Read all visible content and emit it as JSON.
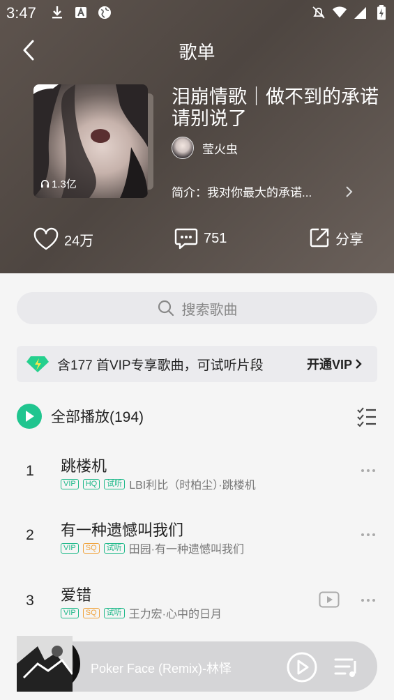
{
  "status_bar": {
    "time": "3:47",
    "left_icons": [
      "download-icon",
      "a-icon",
      "globe-icon"
    ],
    "right_icons": [
      "mute-icon",
      "wifi-icon",
      "signal-icon",
      "battery-icon"
    ]
  },
  "header": {
    "title": "歌单"
  },
  "playlist": {
    "play_count": "1.3亿",
    "title": "泪崩情歌｜做不到的承诺请别说了",
    "creator": "莹火虫",
    "intro": "简介：我对你最大的承诺..."
  },
  "actions": {
    "like_count": "24万",
    "comment_count": "751",
    "share_label": "分享"
  },
  "search": {
    "placeholder": "搜索歌曲"
  },
  "vip_banner": {
    "text": "含177 首VIP专享歌曲，可试听片段",
    "button": "开通VIP"
  },
  "play_all": {
    "label": "全部播放(194)"
  },
  "songs": [
    {
      "index": "1",
      "title": "跳楼机",
      "tags": [
        "VIP",
        "HQ",
        "试听"
      ],
      "meta": "LBI利比（时柏尘）·跳楼机"
    },
    {
      "index": "2",
      "title": "有一种遗憾叫我们",
      "tags": [
        "VIP",
        "SQ",
        "试听"
      ],
      "meta": "田园·有一种遗憾叫我们"
    },
    {
      "index": "3",
      "title": "爱错",
      "tags": [
        "VIP",
        "SQ",
        "试听"
      ],
      "meta": "王力宏·心中的日月"
    }
  ],
  "player": {
    "now_playing": "Poker Face (Remix)-林怿"
  },
  "colors": {
    "accent": "#20c58f",
    "header_bg": "#574e49",
    "sq_tag": "#f0a23b"
  }
}
